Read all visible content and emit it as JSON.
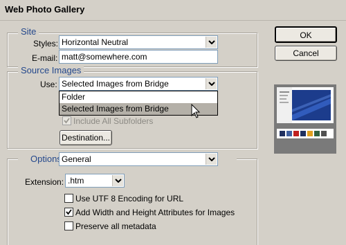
{
  "window": {
    "title": "Web Photo Gallery"
  },
  "site": {
    "legend": "Site",
    "styles_label": "Styles:",
    "styles_value": "Horizontal Neutral",
    "email_label": "E-mail:",
    "email_value": "matt@somewhere.com"
  },
  "source": {
    "legend": "Source Images",
    "use_label": "Use:",
    "use_value": "Selected Images from Bridge",
    "options": [
      "Folder",
      "Selected Images from Bridge"
    ],
    "include_subfolders_label": "Include All Subfolders",
    "destination_label": "Destination..."
  },
  "options": {
    "legend": "Options:",
    "section_value": "General",
    "extension_label": "Extension:",
    "extension_value": ".htm",
    "utf8_label": "Use UTF 8 Encoding for URL",
    "width_height_label": "Add Width and Height Attributes for Images",
    "preserve_label": "Preserve all metadata"
  },
  "checks": {
    "include_subfolders": true,
    "utf8": false,
    "width_height": true,
    "preserve": false
  },
  "buttons": {
    "ok": "OK",
    "cancel": "Cancel"
  },
  "colors": {
    "legend": "#24488c",
    "preview_bg": "#7a7a7a",
    "preview_accent": "#1c3c8c"
  }
}
